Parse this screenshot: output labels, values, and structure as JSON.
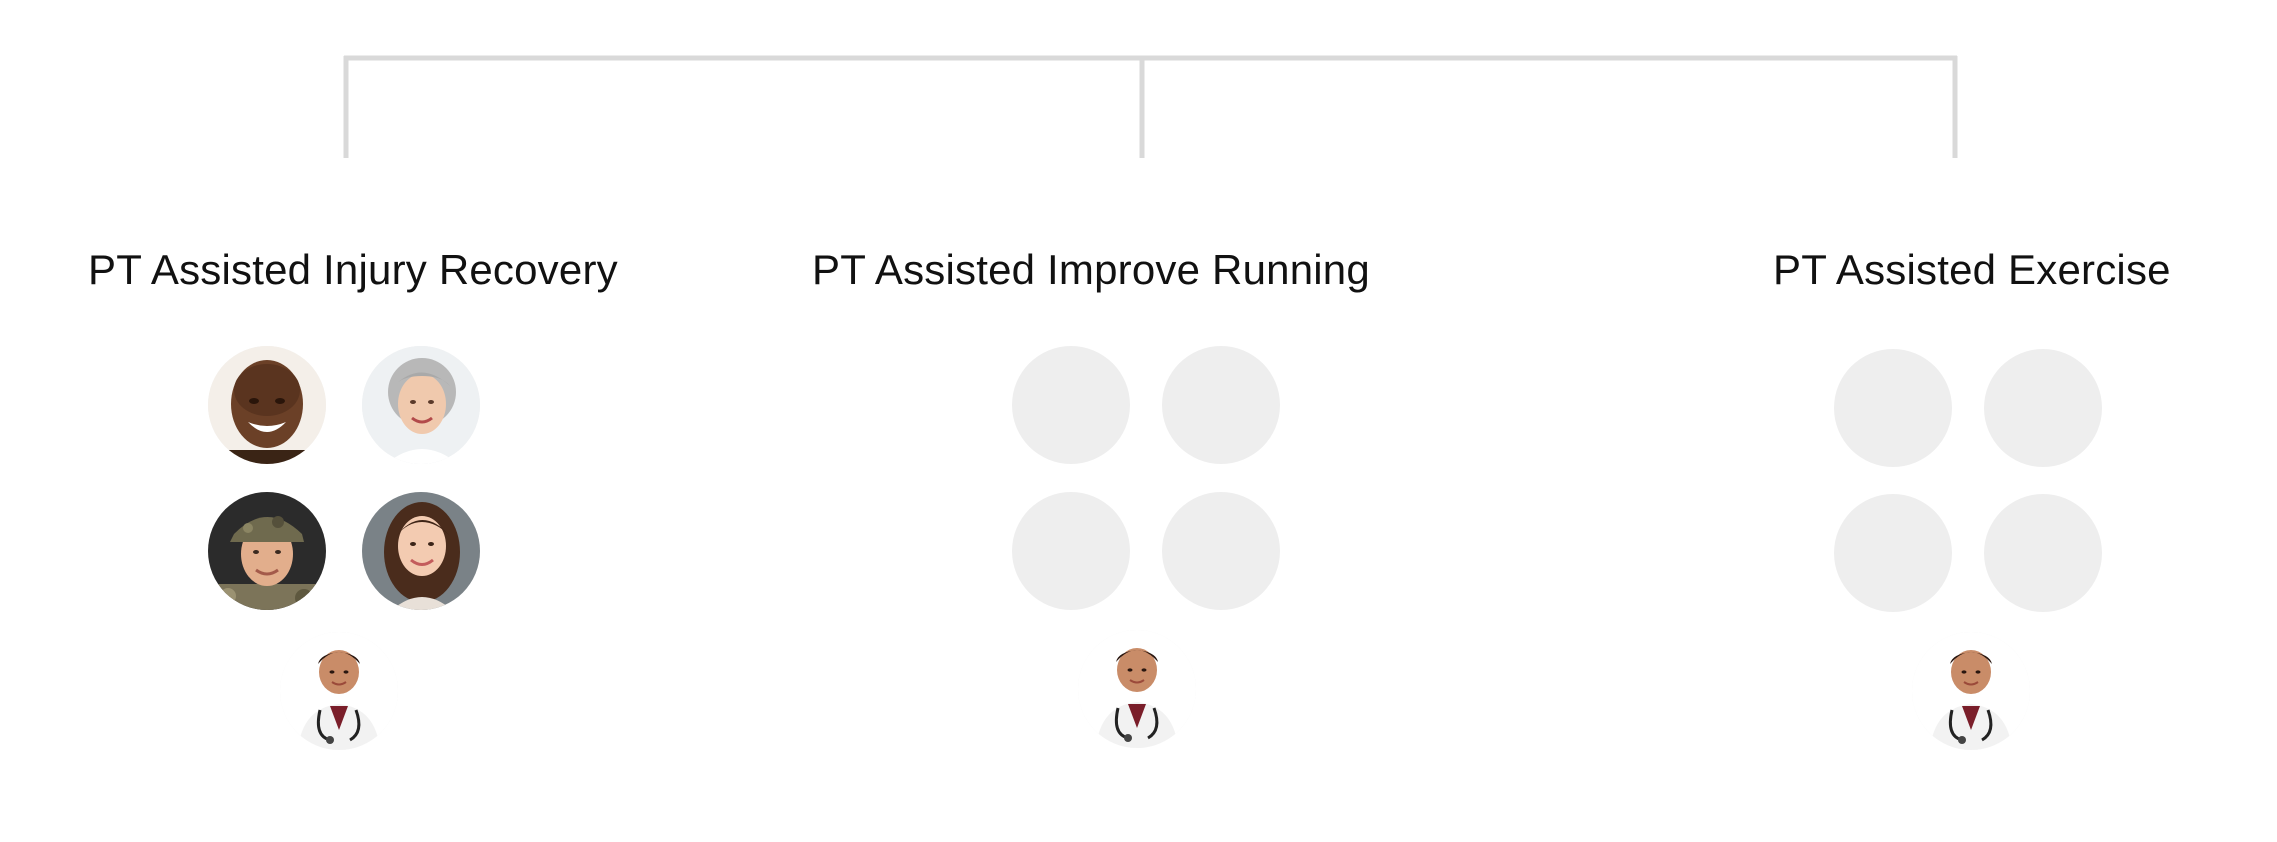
{
  "groups": [
    {
      "title": "PT Assisted Injury Recovery",
      "members": [
        {
          "kind": "photo",
          "icon": "smiling-man-avatar-icon"
        },
        {
          "kind": "photo",
          "icon": "gray-haired-woman-avatar-icon"
        },
        {
          "kind": "photo",
          "icon": "soldier-avatar-icon"
        },
        {
          "kind": "photo",
          "icon": "young-woman-avatar-icon"
        }
      ],
      "therapist_icon": "doctor-avatar-icon"
    },
    {
      "title": "PT Assisted Improve Running",
      "members": [
        {
          "kind": "placeholder",
          "icon": "empty-avatar-slot"
        },
        {
          "kind": "placeholder",
          "icon": "empty-avatar-slot"
        },
        {
          "kind": "placeholder",
          "icon": "empty-avatar-slot"
        },
        {
          "kind": "placeholder",
          "icon": "empty-avatar-slot"
        }
      ],
      "therapist_icon": "doctor-avatar-icon"
    },
    {
      "title": "PT Assisted Exercise",
      "members": [
        {
          "kind": "placeholder",
          "icon": "empty-avatar-slot"
        },
        {
          "kind": "placeholder",
          "icon": "empty-avatar-slot"
        },
        {
          "kind": "placeholder",
          "icon": "empty-avatar-slot"
        },
        {
          "kind": "placeholder",
          "icon": "empty-avatar-slot"
        }
      ],
      "therapist_icon": "doctor-avatar-icon"
    }
  ],
  "colors": {
    "connector": "#d9d9d9",
    "placeholder": "#eeeeee",
    "title_text": "#111111"
  }
}
